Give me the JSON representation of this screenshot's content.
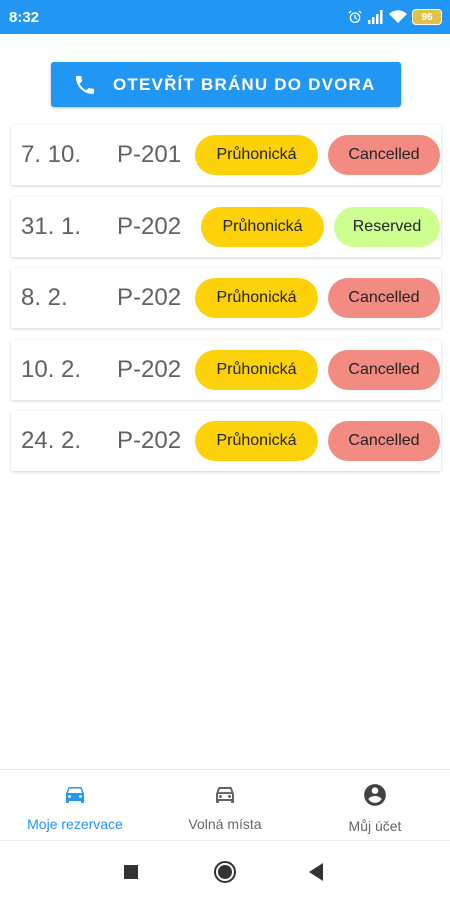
{
  "status_bar": {
    "time": "8:32",
    "battery": "96",
    "icons": [
      "alarm-icon",
      "signal-icon",
      "wifi-icon",
      "battery-icon"
    ]
  },
  "gate_button": {
    "label": "OTEVŘÍT BRÁNU DO DVORA",
    "icon": "phone-icon"
  },
  "reservations": [
    {
      "date": "7. 10.",
      "spot": "P-201",
      "location": "Průhonická",
      "status": "Cancelled",
      "status_color": "#f28b82"
    },
    {
      "date": "31. 1.",
      "spot": "P-202",
      "location": "Průhonická",
      "status": "Reserved",
      "status_color": "#ccff90"
    },
    {
      "date": "8. 2.",
      "spot": "P-202",
      "location": "Průhonická",
      "status": "Cancelled",
      "status_color": "#f28b82"
    },
    {
      "date": "10. 2.",
      "spot": "P-202",
      "location": "Průhonická",
      "status": "Cancelled",
      "status_color": "#f28b82"
    },
    {
      "date": "24. 2.",
      "spot": "P-202",
      "location": "Průhonická",
      "status": "Cancelled",
      "status_color": "#f28b82"
    }
  ],
  "bottom_nav": {
    "items": [
      {
        "label": "Moje rezervace",
        "icon": "car-icon",
        "active": true
      },
      {
        "label": "Volná místa",
        "icon": "car-outline-icon",
        "active": false
      },
      {
        "label": "Můj účet",
        "icon": "account-circle-icon",
        "active": false
      }
    ]
  },
  "colors": {
    "primary": "#2196f3",
    "location_chip": "#fdd20a",
    "cancelled": "#f28b82",
    "reserved": "#ccff90"
  }
}
